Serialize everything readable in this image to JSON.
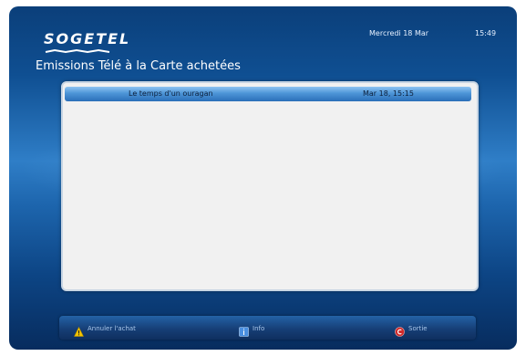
{
  "header": {
    "brand": "SOGETEL",
    "date": "Mercredi 18 Mar",
    "time": "15:49",
    "title": "Emissions Télé à la Carte achetées"
  },
  "list": {
    "rows": [
      {
        "title": "Le temps d'un ouragan",
        "date": "Mar 18, 15:15"
      }
    ]
  },
  "footer": {
    "cancel_label": "Annuler l'achat",
    "info_label": "Info",
    "exit_label": "Sortie",
    "icons": {
      "cancel": "yellow-triangle-icon",
      "info": "blue-square-icon",
      "exit": "red-circle-c-icon"
    }
  },
  "colors": {
    "accent_yellow": "#f3c300",
    "accent_blue": "#4a8fe0",
    "accent_red": "#d12a2a",
    "highlight_row": "#4d95d7"
  }
}
